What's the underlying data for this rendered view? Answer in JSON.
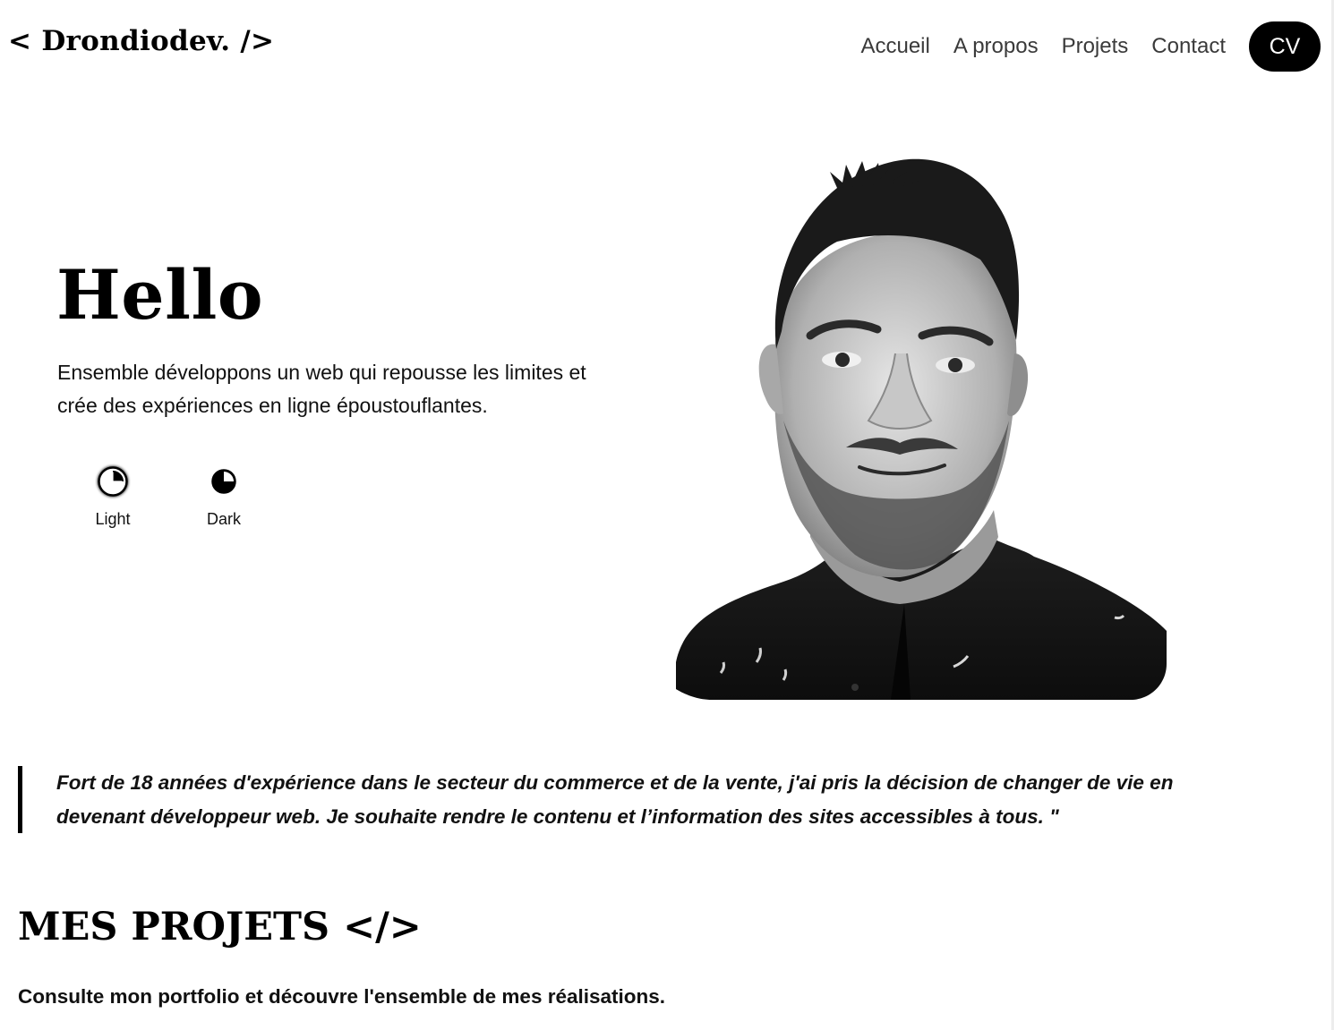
{
  "header": {
    "logo": "< Drondiodev. />",
    "nav": [
      {
        "label": "Accueil"
      },
      {
        "label": "A propos"
      },
      {
        "label": "Projets"
      },
      {
        "label": "Contact"
      }
    ],
    "cv_label": "CV"
  },
  "hero": {
    "title": "Hello",
    "text": "Ensemble développons un web qui repousse les limites et crée des expériences en ligne époustouflantes.",
    "themes": [
      {
        "label": "Light",
        "icon": "light-theme-icon",
        "selected": true
      },
      {
        "label": "Dark",
        "icon": "dark-theme-icon",
        "selected": false
      }
    ],
    "portrait_icon": "portrait-photo"
  },
  "quote": {
    "text": "Fort de 18 années d'expérience dans le secteur du commerce et de la vente, j'ai pris la décision de changer de vie en devenant développeur web. Je souhaite rendre le contenu et l’information des sites accessibles à tous. \""
  },
  "projects": {
    "title": "MES PROJETS </>",
    "subtitle": "Consulte mon portfolio et découvre l'ensemble de mes réalisations."
  },
  "colors": {
    "background": "#ffffff",
    "text": "#000000",
    "nav_text": "#3a3a3a",
    "button_bg": "#000000",
    "button_text": "#ffffff"
  }
}
